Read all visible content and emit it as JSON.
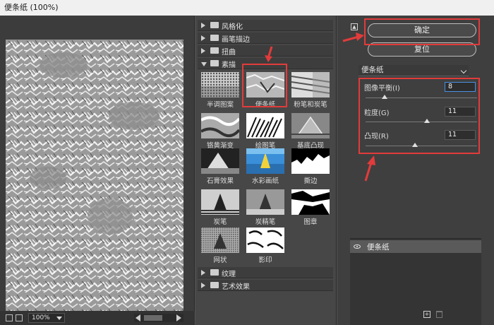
{
  "window": {
    "title": "便条纸 (100%)"
  },
  "preview": {
    "zoom": "100%"
  },
  "gallery": {
    "folders": [
      {
        "label": "风格化",
        "expanded": false
      },
      {
        "label": "画笔描边",
        "expanded": false
      },
      {
        "label": "扭曲",
        "expanded": false
      },
      {
        "label": "素描",
        "expanded": true
      }
    ],
    "thumbnails": [
      {
        "label": "半调图案"
      },
      {
        "label": "便条纸"
      },
      {
        "label": "粉笔和炭笔"
      },
      {
        "label": "铬黄渐变"
      },
      {
        "label": "绘图笔"
      },
      {
        "label": "基底凸现"
      },
      {
        "label": "石膏效果"
      },
      {
        "label": "水彩画纸"
      },
      {
        "label": "撕边"
      },
      {
        "label": "炭笔"
      },
      {
        "label": "炭精笔"
      },
      {
        "label": "图章"
      },
      {
        "label": "网状"
      },
      {
        "label": "影印"
      }
    ],
    "bottom_folders": [
      {
        "label": "纹理"
      },
      {
        "label": "艺术效果"
      }
    ],
    "selected": "便条纸"
  },
  "settings": {
    "ok_label": "确定",
    "reset_label": "复位",
    "filter_select": "便条纸",
    "params": [
      {
        "label": "图像平衡(I)",
        "value": "8",
        "fraction": 0.17
      },
      {
        "label": "粒度(G)",
        "value": "11",
        "fraction": 0.55
      },
      {
        "label": "凸现(R)",
        "value": "11",
        "fraction": 0.44
      }
    ]
  },
  "layers": {
    "items": [
      {
        "name": "便条纸",
        "visible": true
      }
    ]
  },
  "colors": {
    "highlight": "#e23b3b",
    "panel": "#3f3f3f"
  }
}
